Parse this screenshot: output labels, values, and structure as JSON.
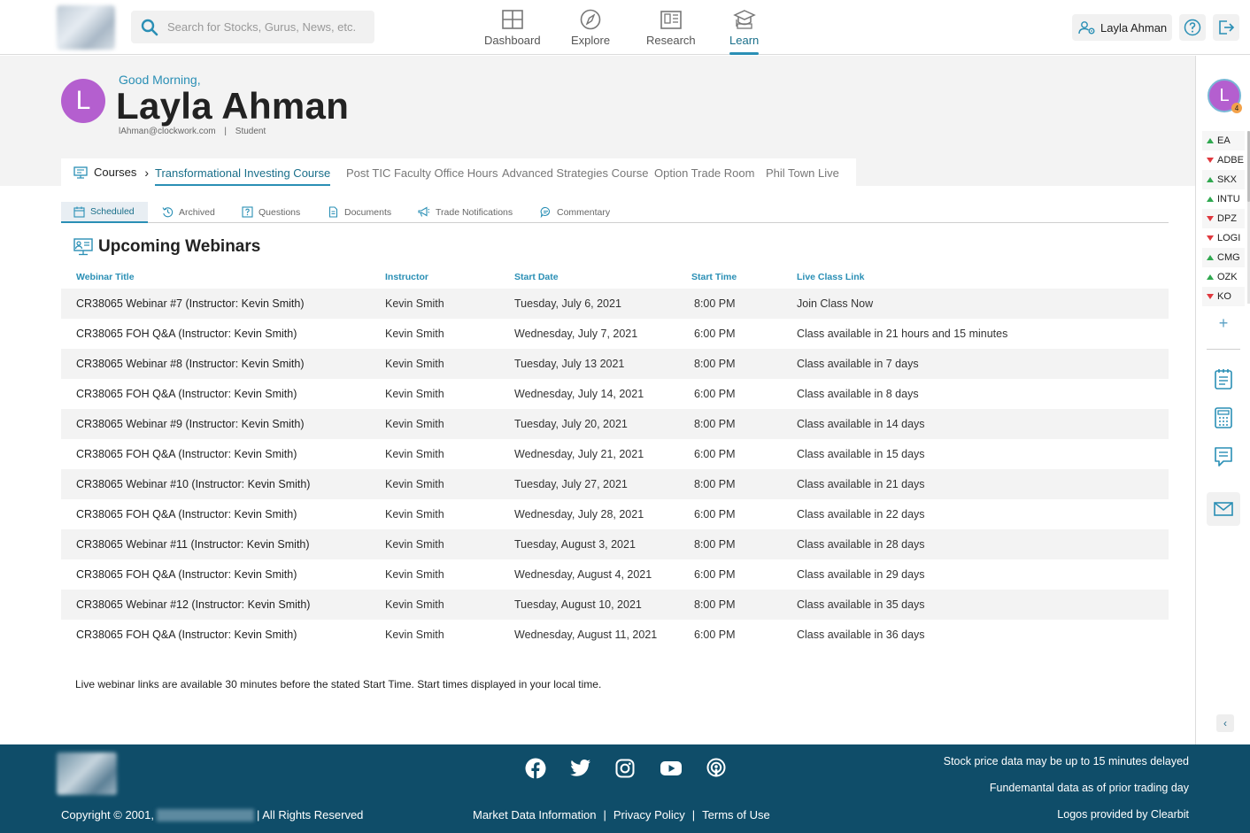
{
  "header": {
    "search_placeholder": "Search for Stocks, Gurus, News, etc.",
    "nav": [
      {
        "label": "Dashboard",
        "icon": "dashboard-icon"
      },
      {
        "label": "Explore",
        "icon": "compass-icon"
      },
      {
        "label": "Research",
        "icon": "research-icon"
      },
      {
        "label": "Learn",
        "icon": "graduation-cap-icon",
        "active": true
      }
    ],
    "user_name": "Layla Ahman"
  },
  "profile": {
    "initial": "L",
    "greeting": "Good Morning,",
    "name": "Layla Ahman",
    "email": "lAhman@clockwork.com",
    "separator": "|",
    "role": "Student"
  },
  "course_nav": {
    "crumb": "Courses",
    "tabs": [
      "Transformational Investing Course",
      "Post TIC Faculty Office Hours",
      "Advanced Strategies Course",
      "Option Trade Room",
      "Phil Town Live"
    ],
    "active_index": 0
  },
  "sub_tabs": [
    "Scheduled",
    "Archived",
    "Questions",
    "Documents",
    "Trade Notifications",
    "Commentary"
  ],
  "section_title": "Upcoming Webinars",
  "table": {
    "headers": [
      "Webinar Title",
      "Instructor",
      "Start Date",
      "Start Time",
      "Live Class Link"
    ],
    "rows": [
      [
        "CR38065 Webinar #7 (Instructor: Kevin Smith)",
        "Kevin Smith",
        "Tuesday, July 6, 2021",
        "8:00 PM",
        "Join Class Now"
      ],
      [
        "CR38065 FOH Q&A (Instructor: Kevin Smith)",
        "Kevin Smith",
        "Wednesday, July 7, 2021",
        "6:00 PM",
        "Class available in 21 hours and 15 minutes"
      ],
      [
        "CR38065 Webinar #8 (Instructor: Kevin Smith)",
        "Kevin Smith",
        "Tuesday, July 13 2021",
        "8:00 PM",
        "Class available in 7 days"
      ],
      [
        "CR38065 FOH Q&A (Instructor: Kevin Smith)",
        "Kevin Smith",
        "Wednesday, July 14, 2021",
        "6:00 PM",
        "Class available in 8 days"
      ],
      [
        "CR38065 Webinar #9 (Instructor: Kevin Smith)",
        "Kevin Smith",
        "Tuesday, July 20, 2021",
        "8:00 PM",
        "Class available in 14 days"
      ],
      [
        "CR38065 FOH Q&A (Instructor: Kevin Smith)",
        "Kevin Smith",
        "Wednesday, July 21, 2021",
        "6:00 PM",
        "Class available in 15 days"
      ],
      [
        "CR38065 Webinar #10 (Instructor: Kevin Smith)",
        "Kevin Smith",
        "Tuesday, July 27, 2021",
        "8:00 PM",
        "Class available in 21 days"
      ],
      [
        "CR38065 FOH Q&A (Instructor: Kevin Smith)",
        "Kevin Smith",
        "Wednesday, July 28, 2021",
        "6:00 PM",
        "Class available in 22 days"
      ],
      [
        "CR38065 Webinar #11 (Instructor: Kevin Smith)",
        "Kevin Smith",
        "Tuesday, August 3, 2021",
        "8:00 PM",
        "Class available in 28 days"
      ],
      [
        "CR38065 FOH Q&A (Instructor: Kevin Smith)",
        "Kevin Smith",
        "Wednesday, August 4, 2021",
        "6:00 PM",
        "Class available in 29 days"
      ],
      [
        "CR38065 Webinar #12 (Instructor: Kevin Smith)",
        "Kevin Smith",
        "Tuesday, August 10, 2021",
        "8:00 PM",
        "Class available in 35 days"
      ],
      [
        "CR38065 FOH Q&A (Instructor: Kevin Smith)",
        "Kevin Smith",
        "Wednesday, August 11, 2021",
        "6:00 PM",
        "Class available in 36 days"
      ]
    ]
  },
  "note": "Live webinar links are available 30 minutes before the stated Start Time. Start times displayed in your local time.",
  "sidebar": {
    "avatar_initial": "L",
    "badge_count": "4",
    "tickers": [
      {
        "symbol": "EA",
        "direction": "up"
      },
      {
        "symbol": "ADBE",
        "direction": "down"
      },
      {
        "symbol": "SKX",
        "direction": "up"
      },
      {
        "symbol": "INTU",
        "direction": "up"
      },
      {
        "symbol": "DPZ",
        "direction": "down"
      },
      {
        "symbol": "LOGI",
        "direction": "down"
      },
      {
        "symbol": "CMG",
        "direction": "up"
      },
      {
        "symbol": "OZK",
        "direction": "up"
      },
      {
        "symbol": "KO",
        "direction": "down"
      }
    ],
    "add_label": "+",
    "collapse_label": "‹"
  },
  "footer": {
    "copyright_prefix": "Copyright © 2001,",
    "copyright_suffix": "| All Rights Reserved",
    "links": [
      "Market Data Information",
      "Privacy Policy",
      "Terms of Use"
    ],
    "link_separator": "|",
    "disclaimers": [
      "Stock price data may be up to 15 minutes delayed",
      "Fundemantal data as of prior trading day",
      "Logos provided by Clearbit"
    ]
  },
  "colors": {
    "accent": "#2a8fb5",
    "avatar": "#b45fcf",
    "footer_bg": "#0f4d69",
    "ticker_up": "#2fa84f",
    "ticker_down": "#e0383e"
  }
}
